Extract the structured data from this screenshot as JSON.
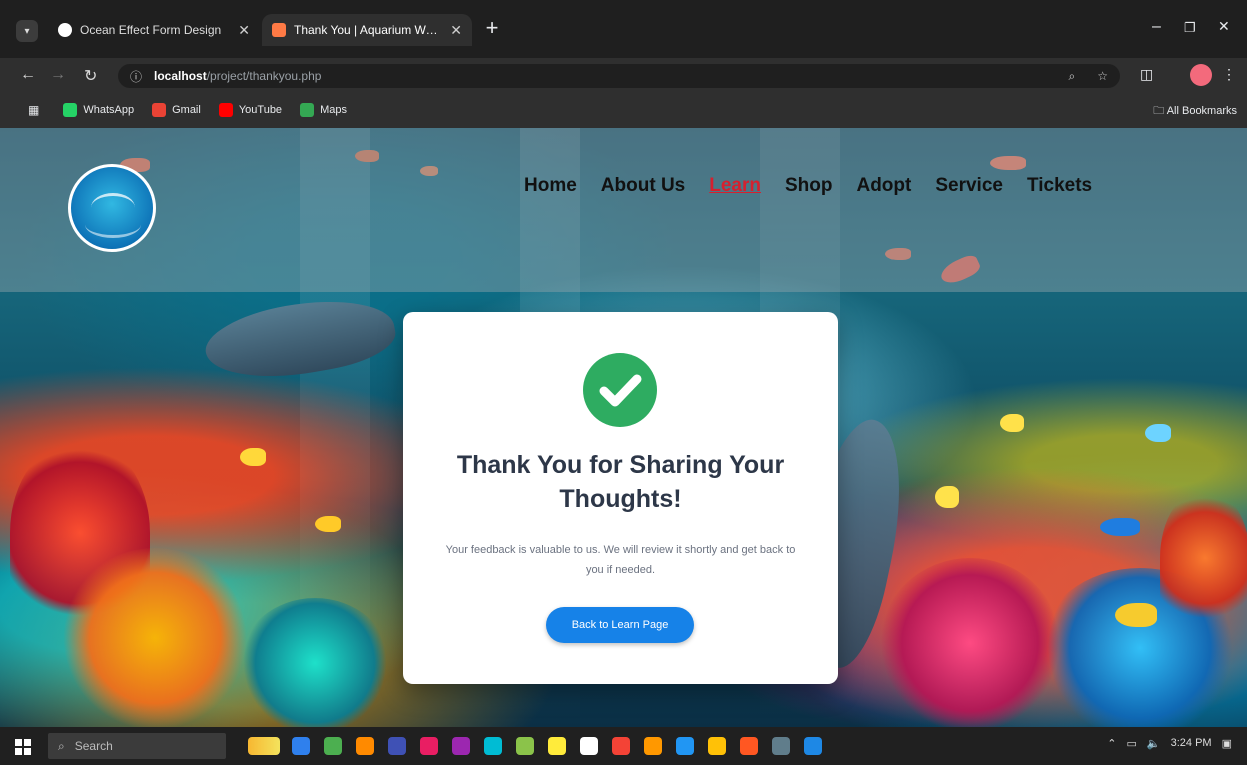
{
  "browser": {
    "tabs": [
      {
        "title": "Ocean Effect Form Design"
      },
      {
        "title": "Thank You | Aquarium World"
      }
    ],
    "new_tab_label": "+",
    "window_controls": {
      "minimize": "–",
      "maximize": "❐",
      "close": "✕"
    },
    "nav": {
      "back": "←",
      "forward": "→",
      "reload": "↻"
    },
    "address": {
      "host": "localhost",
      "path": "/project/thankyou.php"
    },
    "bookmarks": [
      {
        "label": "WhatsApp",
        "color": "#25d366"
      },
      {
        "label": "Gmail",
        "color": "#ea4335"
      },
      {
        "label": "YouTube",
        "color": "#ff0000"
      },
      {
        "label": "Maps",
        "color": "#34a853"
      }
    ],
    "all_bookmarks_label": "All Bookmarks"
  },
  "site": {
    "nav": [
      {
        "label": "Home"
      },
      {
        "label": "About Us"
      },
      {
        "label": "Learn",
        "active": true
      },
      {
        "label": "Shop"
      },
      {
        "label": "Adopt"
      },
      {
        "label": "Service"
      },
      {
        "label": "Tickets"
      }
    ]
  },
  "thank_you": {
    "title": "Thank You for Sharing Your Thoughts!",
    "message": "Your feedback is valuable to us. We will review it shortly and get back to you if needed.",
    "button_label": "Back to Learn Page"
  },
  "taskbar": {
    "search_placeholder": "Search",
    "time": "3:24 PM",
    "apps": [
      "#f7b731",
      "#2f80ed",
      "#4caf50",
      "#ff8a00",
      "#3f51b5",
      "#e91e63",
      "#9c27b0",
      "#00bcd4",
      "#8bc34a",
      "#ffeb3b",
      "#fff",
      "#f44336",
      "#ff9800"
    ]
  },
  "colors": {
    "accent_blue": "#1682e8",
    "success_green": "#2eac61",
    "nav_active_red": "#d6202f"
  }
}
